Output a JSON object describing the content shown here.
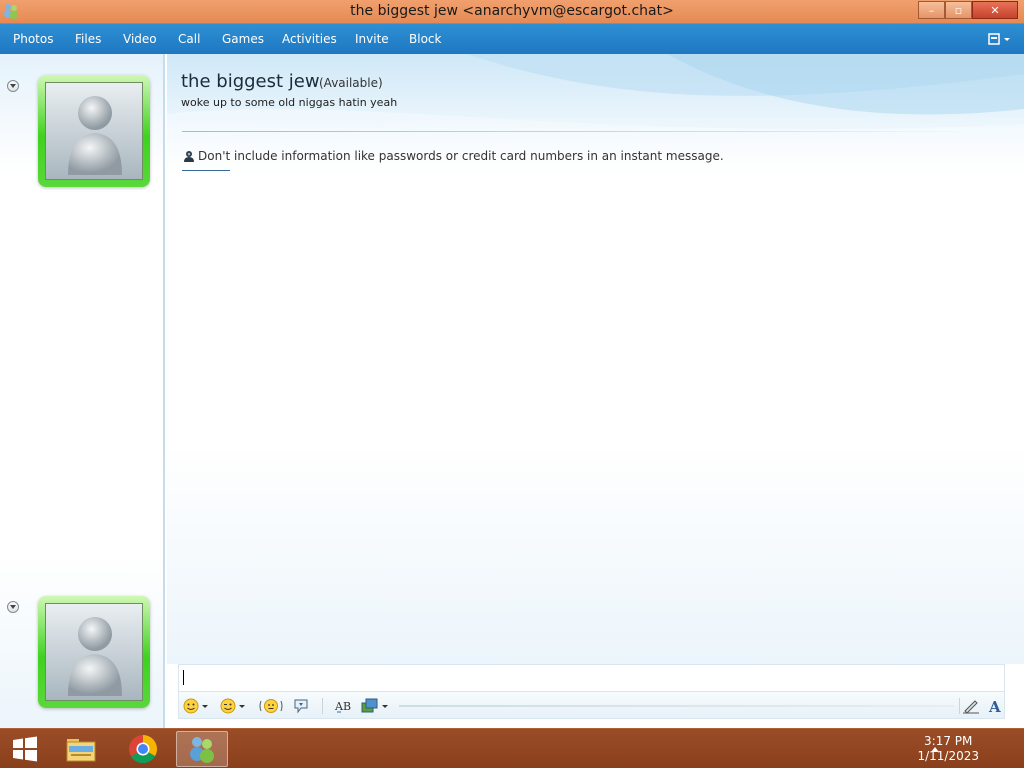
{
  "window": {
    "title": "the biggest jew <anarchyvm@escargot.chat>",
    "controls": {
      "minimize": "–",
      "maximize": "▫",
      "close": "✕"
    }
  },
  "menu": {
    "items": [
      "Photos",
      "Files",
      "Video",
      "Call",
      "Games",
      "Activities",
      "Invite",
      "Block"
    ],
    "options_icon": "options-menu-icon"
  },
  "contact": {
    "name": "the biggest jew",
    "status": "(Available)",
    "personal_message": "woke up to some old niggas hatin yeah"
  },
  "conversation": {
    "notice": "Don't include information like passwords or credit card numbers in an instant message."
  },
  "input": {
    "value": ""
  },
  "toolbar": {
    "icons": [
      "emoticon-icon",
      "wink-icon",
      "nudge-icon",
      "voice-clip-icon",
      "spellcheck-icon",
      "background-icon",
      "handwriting-icon",
      "font-icon"
    ]
  },
  "taskbar": {
    "icons": [
      "windows-start-icon",
      "file-explorer-icon",
      "chrome-icon",
      "messenger-icon"
    ],
    "time": "3:17 PM",
    "date": "1/11/2023"
  },
  "colors": {
    "titlebar": "#e58a55",
    "menubar": "#1e78c2",
    "avatar_frame": "#3fd21f",
    "taskbar": "#8a3f1c"
  }
}
